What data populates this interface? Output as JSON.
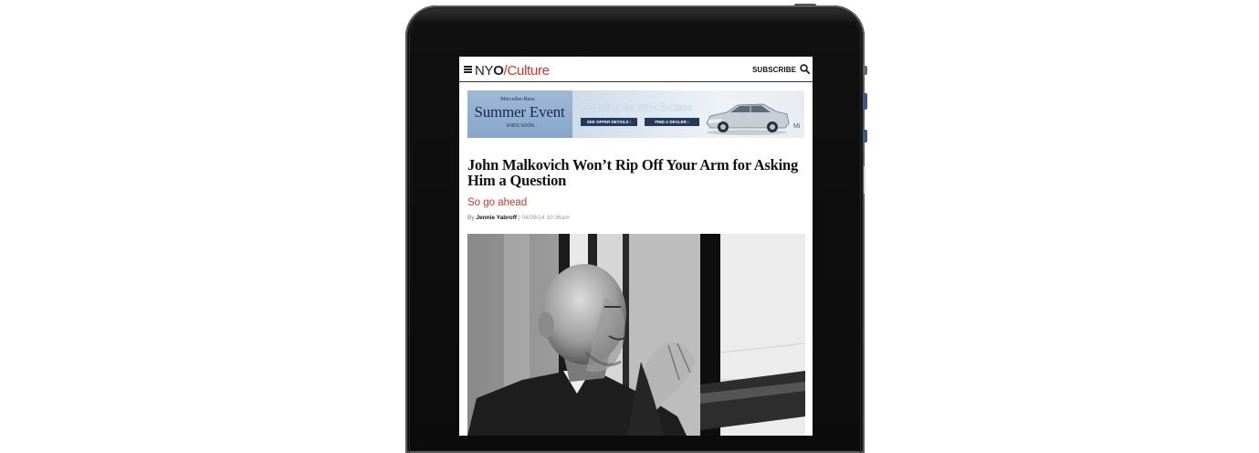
{
  "site": {
    "logo_prefix": "NY",
    "logo_o": "O",
    "logo_slash": "/",
    "section": "Culture",
    "subscribe_label": "SUBSCRIBE"
  },
  "ad": {
    "brand": "Mercedes-Benz",
    "title": "Summer Event",
    "ends": "ENDS SOON",
    "feature": "Featuring the 2014 E-Class.",
    "button1": "SEE OFFER DETAILS ›",
    "button2": "FIND A DEALER ›",
    "corner_text": "Mi"
  },
  "article": {
    "headline": "John Malkovich Won’t Rip Off Your Arm for Asking Him a Question",
    "subhead": "So go ahead",
    "by_label": "By",
    "author": "Jennie Yabroff",
    "separator": "|",
    "date": "04/09/14 10:36am"
  },
  "colors": {
    "accent": "#c9372c",
    "text": "#111111",
    "ad_navy": "#243a5c"
  },
  "icons": [
    "menu-icon",
    "search-icon"
  ]
}
